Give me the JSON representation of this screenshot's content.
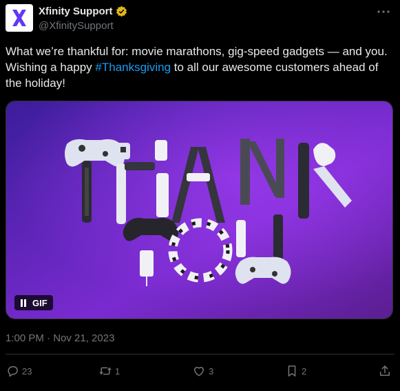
{
  "account": {
    "name": "Xfinity Support",
    "handle": "@XfinitySupport",
    "avatar_letter": "X",
    "avatar_color": "#6138f5",
    "verified_color": "#e2b719"
  },
  "tweet": {
    "text_before": "What we’re thankful for: movie marathons, gig-speed gadgets — and you. Wishing a happy ",
    "hashtag": "#Thanksgiving",
    "text_after": " to all our awesome customers ahead of the holiday!"
  },
  "media": {
    "type": "gif",
    "badge_label": "GIF",
    "scene": "purple background with remotes, game controllers, routers and cameras arranged to spell THANK YOU",
    "line1": "THANK",
    "line2": "YOU",
    "gradient_start": "#3b1d9a",
    "gradient_end": "#9a2bd6"
  },
  "timestamp": "1:00 PM · Nov 21, 2023",
  "actions": {
    "replies": "23",
    "retweets": "1",
    "likes": "3",
    "bookmarks": "2"
  },
  "colors": {
    "link": "#1d9bf0",
    "muted": "#71767b",
    "text": "#e7e9ea",
    "background": "#000000"
  }
}
